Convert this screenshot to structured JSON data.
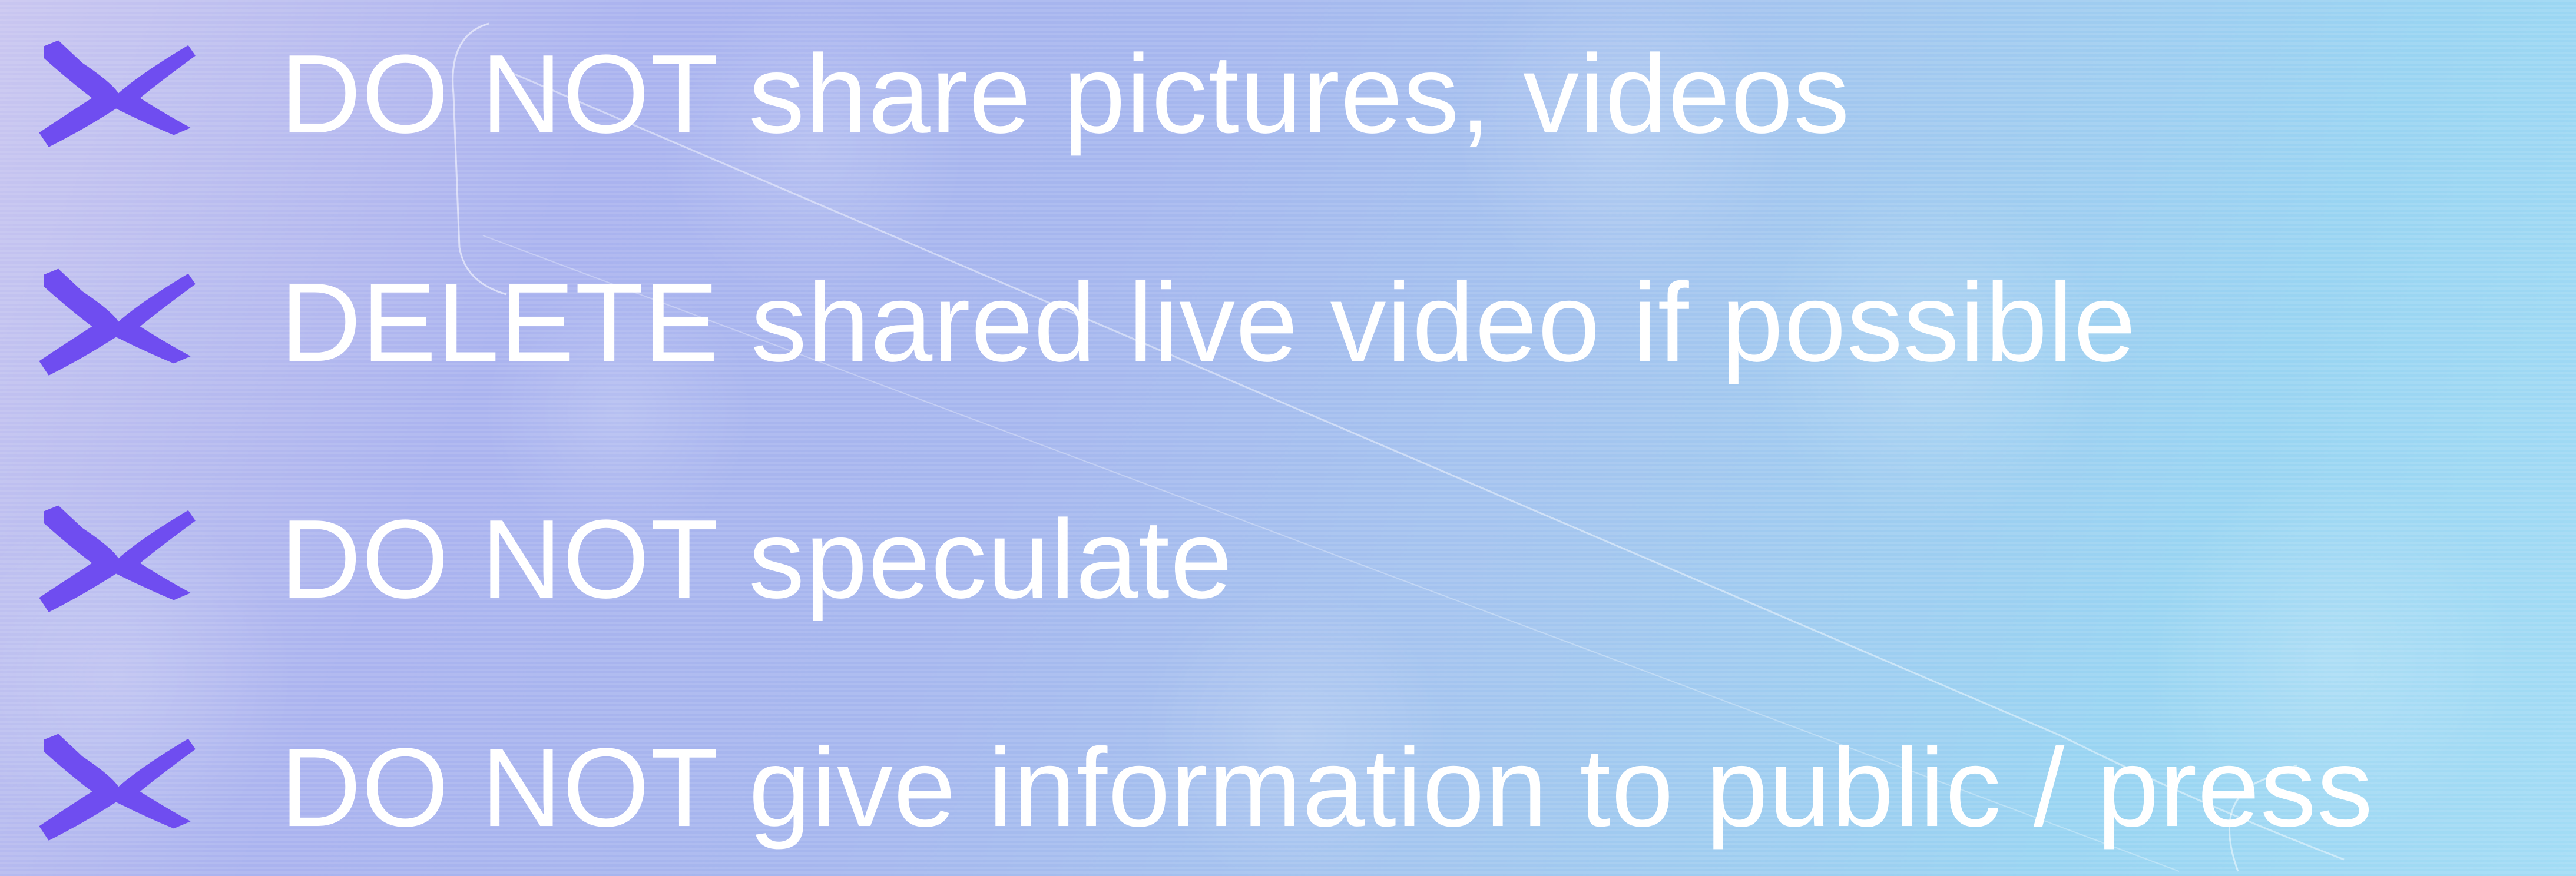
{
  "slide": {
    "icon": "x-mark-icon",
    "colors": {
      "icon": "#6f4df0",
      "text": "#ffffff",
      "background_start": "#c9c6f0",
      "background_end": "#a3dcf5"
    },
    "items": [
      {
        "emphasis": "DO NOT",
        "rest": "share pictures, videos"
      },
      {
        "emphasis": "DELETE",
        "rest": "shared live video if possible"
      },
      {
        "emphasis": "DO NOT",
        "rest": "speculate"
      },
      {
        "emphasis": "DO NOT",
        "rest": "give information to public / press"
      }
    ]
  }
}
